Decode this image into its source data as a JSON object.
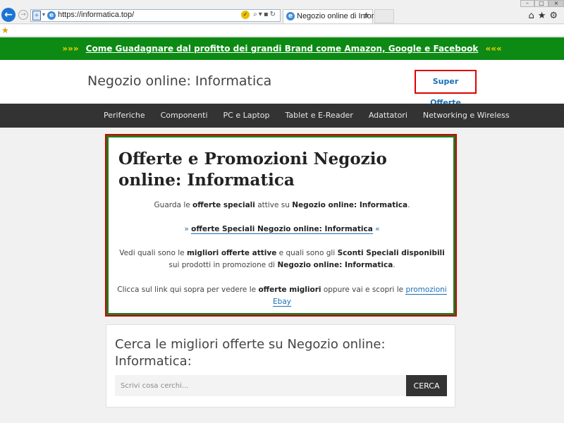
{
  "browser": {
    "url": "https://informatica.top/",
    "tab_title": "Negozio online di Infor...",
    "tab_close": "×",
    "win_min": "–",
    "win_max": "□",
    "win_close": "×",
    "tools": "⌂★⚙"
  },
  "promo": {
    "left_mark": "»»»",
    "link_text": "Come Guadagnare dal profitto dei grandi Brand come Amazon, Google e Facebook",
    "right_mark": "«««"
  },
  "header": {
    "site_title": "Negozio online: Informatica",
    "super_offerte": "Super Offerte"
  },
  "nav": {
    "items": [
      "Periferiche",
      "Componenti",
      "PC e Laptop",
      "Tablet e E-Reader",
      "Adattatori",
      "Networking e Wireless"
    ]
  },
  "offer": {
    "title": "Offerte e Promozioni Negozio online: Informatica",
    "p1": {
      "t1": "Guarda le ",
      "b1": "offerte speciali",
      "t2": " attive su ",
      "b2": "Negozio online: Informatica",
      "t3": "."
    },
    "p2": {
      "left": "» ",
      "link": "offerte Speciali Negozio online: Informatica",
      "right": " «"
    },
    "p3": {
      "t1": "Vedi quali sono le ",
      "b1": "migliori offerte attive",
      "t2": " e quali sono gli ",
      "b2": "Sconti Speciali disponibili",
      "t3": " sui prodotti in promozione di ",
      "b3": "Negozio online: Informatica",
      "t4": "."
    },
    "p4": {
      "t1": "Clicca sul link qui sopra per vedere le ",
      "b1": "offerte migliori",
      "t2": " oppure vai e scopri le ",
      "link": "promozioni Ebay"
    }
  },
  "search": {
    "title": "Cerca le migliori offerte su Negozio online: Informatica:",
    "placeholder": "Scrivi cosa cerchi...",
    "button": "CERCA"
  },
  "colors": {
    "promo_bg": "#0c8a14",
    "nav_bg": "#333333",
    "offer_border_green": "#1f7a1f",
    "offer_border_red": "#d00000",
    "link_blue": "#1a6fb5"
  }
}
